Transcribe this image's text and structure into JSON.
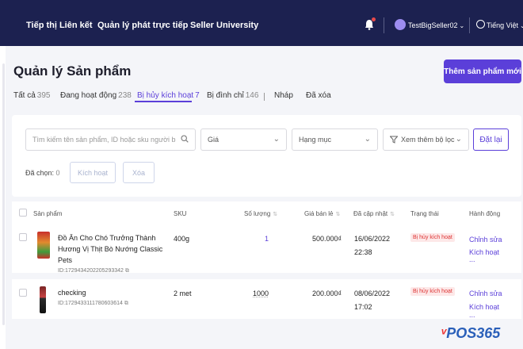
{
  "topnav": {
    "items": [
      "Tiếp thị Liên kết",
      "Quản lý phát trực tiếp",
      "Seller University"
    ],
    "username": "TestBigSeller02",
    "language": "Tiếng Việt"
  },
  "page": {
    "title": "Quản lý Sản phẩm",
    "add_button": "Thêm sản phẩm mới"
  },
  "tabs": [
    {
      "label": "Tất cả",
      "count": "395"
    },
    {
      "label": "Đang hoạt động",
      "count": "238"
    },
    {
      "label": "Bị hủy kích hoạt",
      "count": "7"
    },
    {
      "label": "Bị đình chỉ",
      "count": "146"
    },
    {
      "label": "Nháp",
      "count": ""
    },
    {
      "label": "Đã xóa",
      "count": ""
    }
  ],
  "filters": {
    "search_placeholder": "Tìm kiếm tên sản phẩm, ID hoặc sku người b",
    "price": "Giá",
    "category": "Hạng mục",
    "more": "Xem thêm bộ lọc",
    "reset": "Đặt lại"
  },
  "selection": {
    "label": "Đã chọn:",
    "count": "0",
    "activate": "Kích hoạt",
    "delete": "Xóa"
  },
  "table": {
    "headers": [
      "Sản phẩm",
      "SKU",
      "Số lượng",
      "Giá bán lẻ",
      "Đã cập nhật",
      "Trạng thái",
      "Hành động"
    ],
    "rows": [
      {
        "name": "Đồ Ăn Cho Chó Trưởng Thành Hương Vị Thịt Bò Nướng Classic Pets",
        "id": "ID:1729434202205293342",
        "sku": "400g",
        "qty": "1",
        "price": "500.000₫",
        "date": "16/06/2022",
        "time": "22:38",
        "status": "Bị hủy kích hoạt",
        "actions": [
          "Chỉnh sửa",
          "Kích hoạt"
        ]
      },
      {
        "name": "checking",
        "id": "ID:1729433111780603614",
        "sku": "2 met",
        "qty": "1000",
        "price": "200.000₫",
        "date": "08/06/2022",
        "time": "17:02",
        "status": "Bị hủy kích hoạt",
        "actions": [
          "Chỉnh sửa",
          "Kích hoạt"
        ]
      }
    ],
    "more": "..."
  },
  "brand": "POS365"
}
